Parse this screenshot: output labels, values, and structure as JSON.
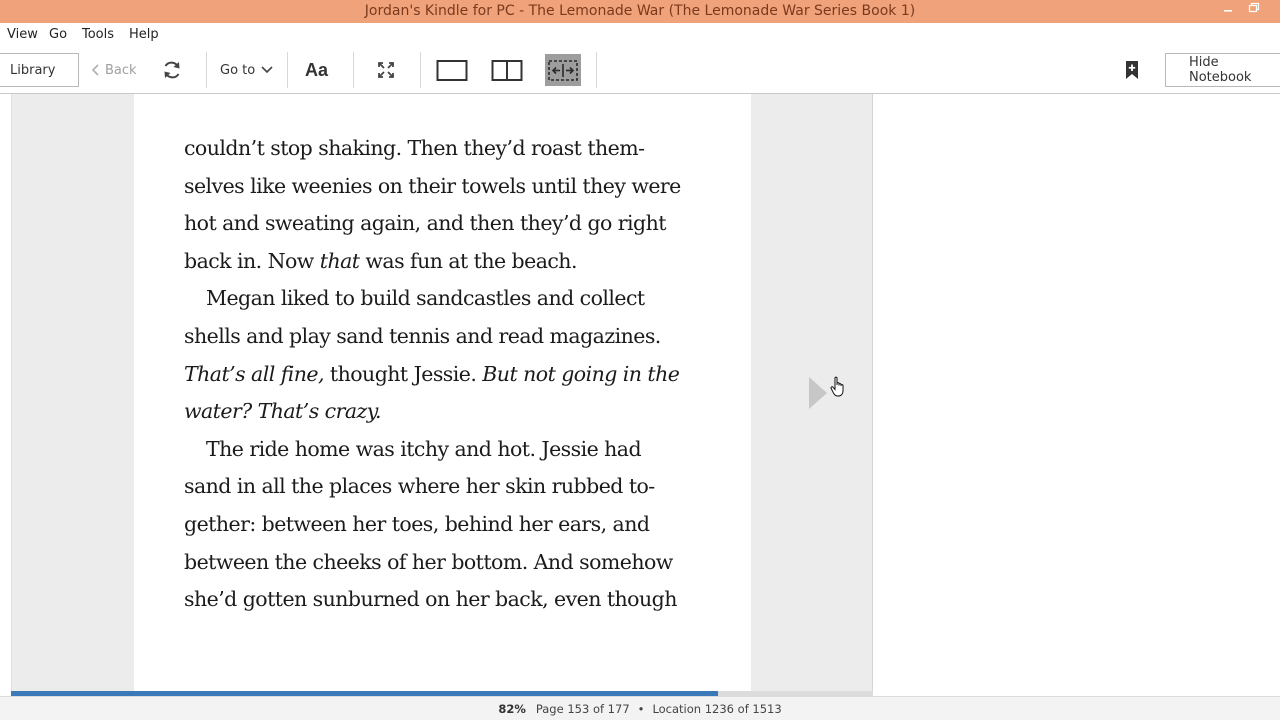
{
  "window": {
    "title": "Jordan's Kindle for PC - The Lemonade War (The Lemonade War Series Book 1)"
  },
  "menu": {
    "items": [
      "View",
      "Go",
      "Tools",
      "Help"
    ]
  },
  "toolbar": {
    "library_label": "Library",
    "back_label": "Back",
    "goto_label": "Go to",
    "font_label": "Aa",
    "hide_notebook_label": "Hide Notebook"
  },
  "book": {
    "lines": [
      {
        "segments": [
          {
            "t": "couldn’t stop shaking. Then they’d roast them-",
            "i": false
          }
        ]
      },
      {
        "segments": [
          {
            "t": "selves like weenies on their towels until they were",
            "i": false
          }
        ]
      },
      {
        "segments": [
          {
            "t": "hot and sweating again, and then they’d go right",
            "i": false
          }
        ]
      },
      {
        "segments": [
          {
            "t": "back in. Now ",
            "i": false
          },
          {
            "t": "that",
            "i": true
          },
          {
            "t": " was fun at the beach.",
            "i": false
          }
        ]
      },
      {
        "indent": true,
        "segments": [
          {
            "t": "Megan liked to build sandcastles and collect",
            "i": false
          }
        ]
      },
      {
        "segments": [
          {
            "t": "shells and play sand tennis and read magazines.",
            "i": false
          }
        ]
      },
      {
        "segments": [
          {
            "t": "That’s all fine,",
            "i": true
          },
          {
            "t": " thought Jessie. ",
            "i": false
          },
          {
            "t": "But not going in the",
            "i": true
          }
        ]
      },
      {
        "segments": [
          {
            "t": "water? That’s crazy.",
            "i": true
          }
        ]
      },
      {
        "indent": true,
        "segments": [
          {
            "t": "The ride home was itchy and hot. Jessie had",
            "i": false
          }
        ]
      },
      {
        "segments": [
          {
            "t": "sand in all the places where her skin rubbed to-",
            "i": false
          }
        ]
      },
      {
        "segments": [
          {
            "t": "gether: between her toes, behind her ears, and",
            "i": false
          }
        ]
      },
      {
        "segments": [
          {
            "t": "between the cheeks of her bottom. And somehow",
            "i": false
          }
        ]
      },
      {
        "segments": [
          {
            "t": "she’d gotten sunburned on her back, even though",
            "i": false
          }
        ]
      }
    ]
  },
  "status": {
    "percent": "82%",
    "page": "Page 153 of 177",
    "location": "Location 1236 of 1513",
    "progress_fraction": 0.82
  },
  "colors": {
    "titlebar": "#f0a27a",
    "progress": "#3b79b8",
    "selected_view": "#9d9d9d"
  }
}
